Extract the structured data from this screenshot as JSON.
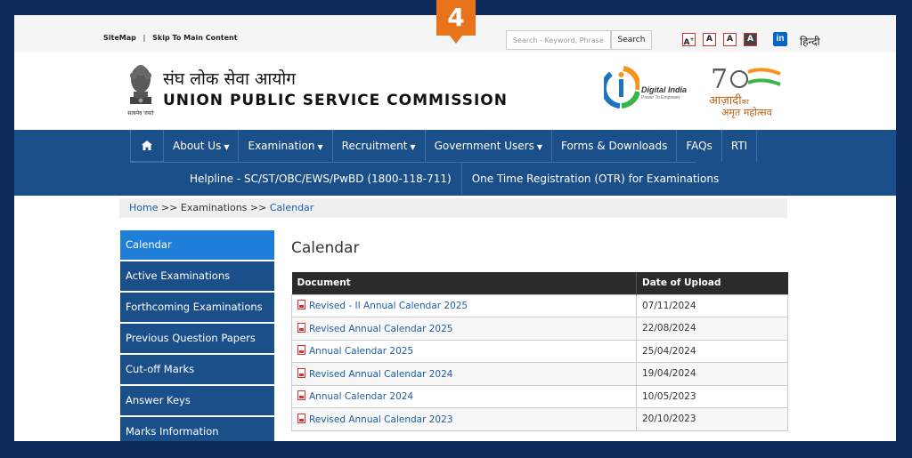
{
  "step_badge": "4",
  "topbar": {
    "sitemap": "SiteMap",
    "separator": "|",
    "skip": "Skip To Main Content",
    "search_placeholder": "Search - Keyword, Phrase",
    "search_button": "Search",
    "font_sizes": [
      "A",
      "A",
      "A",
      "A"
    ],
    "font_increase_sup": "+",
    "linkedin": "in",
    "language": "हिन्दी"
  },
  "header": {
    "hindi_name": "संघ लोक सेवा आयोग",
    "english_name": "UNION PUBLIC SERVICE COMMISSION",
    "emblem_caption": "सत्यमेव जयते",
    "digital_india_title": "Digital India",
    "digital_india_sub": "Power To Empower",
    "azadi_line1": "आज़ादी",
    "azadi_line1_suffix": "का",
    "azadi_line2": "अमृत महोत्सव"
  },
  "nav": {
    "row1": [
      {
        "label": "About Us",
        "dropdown": true
      },
      {
        "label": "Examination",
        "dropdown": true
      },
      {
        "label": "Recruitment",
        "dropdown": true
      },
      {
        "label": "Government Users",
        "dropdown": true
      },
      {
        "label": "Forms & Downloads",
        "dropdown": false
      },
      {
        "label": "FAQs",
        "dropdown": false
      },
      {
        "label": "RTI",
        "dropdown": false
      }
    ],
    "row2": [
      {
        "label": "Helpline - SC/ST/OBC/EWS/PwBD (1800-118-711)"
      },
      {
        "label": "One Time Registration (OTR) for Examinations"
      }
    ]
  },
  "breadcrumb": {
    "home": "Home",
    "sep": ">>",
    "section": "Examinations",
    "current": "Calendar"
  },
  "sidebar": {
    "items": [
      {
        "label": "Calendar",
        "active": true
      },
      {
        "label": "Active Examinations",
        "active": false
      },
      {
        "label": "Forthcoming Examinations",
        "active": false
      },
      {
        "label": "Previous Question Papers",
        "active": false
      },
      {
        "label": "Cut-off Marks",
        "active": false
      },
      {
        "label": "Answer Keys",
        "active": false
      },
      {
        "label": "Marks Information",
        "active": false
      }
    ]
  },
  "main": {
    "title": "Calendar",
    "table": {
      "headers": [
        "Document",
        "Date of Upload"
      ],
      "rows": [
        {
          "document": "Revised - II Annual Calendar 2025",
          "date": "07/11/2024"
        },
        {
          "document": "Revised Annual Calendar 2025",
          "date": "22/08/2024"
        },
        {
          "document": "Annual Calendar 2025",
          "date": "25/04/2024"
        },
        {
          "document": "Revised Annual Calendar 2024",
          "date": "19/04/2024"
        },
        {
          "document": "Annual Calendar 2024",
          "date": "10/05/2023"
        },
        {
          "document": "Revised Annual Calendar 2023",
          "date": "20/10/2023"
        }
      ]
    }
  },
  "colors": {
    "page_bg": "#0d2a5c",
    "nav_bg": "#1b4f8a",
    "sidebar_active": "#1e7ed8",
    "badge": "#e8731a",
    "link": "#1b5fa8"
  }
}
